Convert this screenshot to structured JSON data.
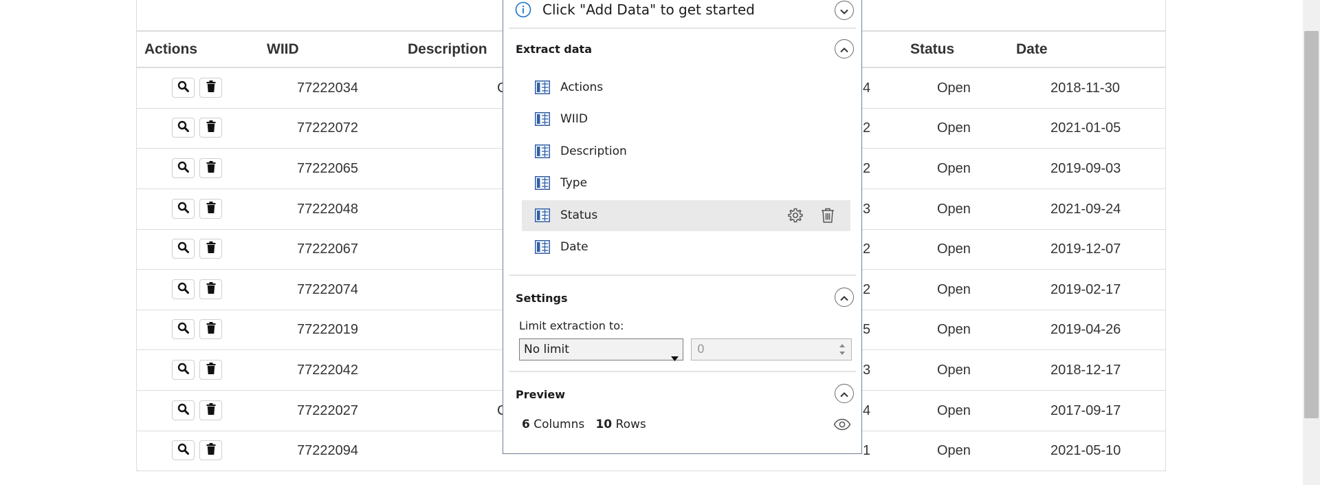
{
  "table": {
    "headers": [
      "Actions",
      "WIID",
      "Description",
      "Status",
      "Date"
    ],
    "rows": [
      {
        "wiid": "77222034",
        "type_frag": "4",
        "status": "Open",
        "date": "2018-11-30",
        "desc_frag": "C"
      },
      {
        "wiid": "77222072",
        "type_frag": "2",
        "status": "Open",
        "date": "2021-01-05",
        "desc_frag": ""
      },
      {
        "wiid": "77222065",
        "type_frag": "2",
        "status": "Open",
        "date": "2019-09-03",
        "desc_frag": ""
      },
      {
        "wiid": "77222048",
        "type_frag": "3",
        "status": "Open",
        "date": "2021-09-24",
        "desc_frag": ""
      },
      {
        "wiid": "77222067",
        "type_frag": "2",
        "status": "Open",
        "date": "2019-12-07",
        "desc_frag": ""
      },
      {
        "wiid": "77222074",
        "type_frag": "2",
        "status": "Open",
        "date": "2019-02-17",
        "desc_frag": ""
      },
      {
        "wiid": "77222019",
        "type_frag": "5",
        "status": "Open",
        "date": "2019-04-26",
        "desc_frag": ""
      },
      {
        "wiid": "77222042",
        "type_frag": "3",
        "status": "Open",
        "date": "2018-12-17",
        "desc_frag": ""
      },
      {
        "wiid": "77222027",
        "type_frag": "4",
        "status": "Open",
        "date": "2017-09-17",
        "desc_frag": "C"
      },
      {
        "wiid": "77222094",
        "type_frag": "1",
        "status": "Open",
        "date": "2021-05-10",
        "desc_frag": ""
      }
    ],
    "row_icons": [
      "search-icon",
      "trash-icon"
    ]
  },
  "panel": {
    "info_text": "Click \"Add Data\" to get started",
    "extract_title": "Extract data",
    "fields": [
      {
        "label": "Actions",
        "selected": false
      },
      {
        "label": "WIID",
        "selected": false
      },
      {
        "label": "Description",
        "selected": false
      },
      {
        "label": "Type",
        "selected": false
      },
      {
        "label": "Status",
        "selected": true
      },
      {
        "label": "Date",
        "selected": false
      }
    ],
    "settings_title": "Settings",
    "limit_label": "Limit extraction to:",
    "limit_value": "No limit",
    "limit_count": "0",
    "preview_title": "Preview",
    "columns_count": "6",
    "columns_label": "Columns",
    "rows_count": "10",
    "rows_label": "Rows"
  },
  "colors": {
    "info_blue": "#1a73c8",
    "field_icon_blue": "#2f5ea8",
    "selected_bg": "#e9e9e9"
  }
}
